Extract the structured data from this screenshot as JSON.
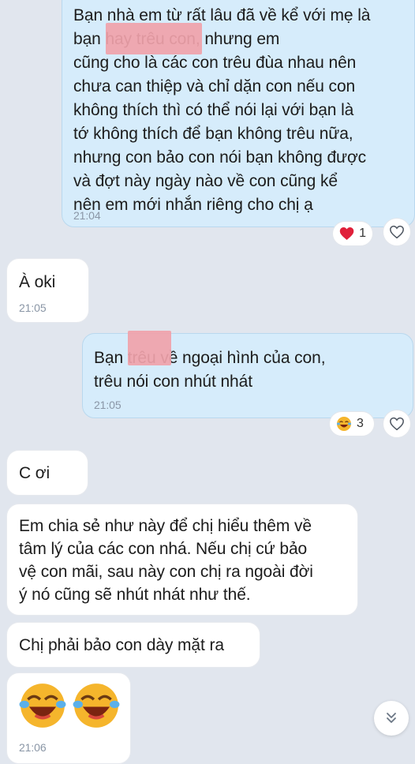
{
  "messages": [
    {
      "id": "m1",
      "side": "sent",
      "lines": [
        "Bạn nhà em từ rất lâu đã về kể với mẹ là",
        "bạn                   hay trêu con, nhưng em",
        "cũng cho là các con trêu đùa nhau nên",
        "chưa can thiệp và chỉ dặn con nếu con",
        "không thích thì có thể nói lại với bạn là",
        "tớ không thích để bạn không trêu nữa,",
        "nhưng con bảo con nói bạn không được",
        "và đợt này ngày nào về con cũng kể",
        "nên em mới nhắn riêng cho chị ạ"
      ],
      "time": "21:04",
      "reaction": {
        "emoji": "heart",
        "count": "1"
      }
    },
    {
      "id": "m2",
      "side": "received",
      "lines": [
        "À oki"
      ],
      "time": "21:05"
    },
    {
      "id": "m3",
      "side": "sent",
      "lines": [
        "Bạn          trêu về ngoại hình của con,",
        "trêu nói con nhút nhát"
      ],
      "time": "21:05",
      "reaction": {
        "emoji": "laughing-crying-face",
        "count": "3"
      }
    },
    {
      "id": "m4",
      "side": "received",
      "lines": [
        "C ơi"
      ]
    },
    {
      "id": "m5",
      "side": "received",
      "lines": [
        "Em chia sẻ như này để chị hiểu thêm về",
        "tâm lý của các con nhá. Nếu chị cứ bảo",
        "vệ con mãi, sau này con chị ra ngoài đời",
        "ý nó cũng sẽ nhút nhát như thế."
      ]
    },
    {
      "id": "m6",
      "side": "received",
      "lines": [
        "Chị phải bảo con dày mặt ra"
      ]
    },
    {
      "id": "m7",
      "side": "received",
      "sticker": [
        "laughing-crying-face",
        "laughing-crying-face"
      ],
      "time": "21:06"
    }
  ],
  "colors": {
    "background": "#e1e6ee",
    "sent_bubble": "#d6ecfb",
    "received_bubble": "#ffffff",
    "time_text": "#8a96a6",
    "redaction": "#f0a2aa",
    "heart": "#e0203a"
  },
  "controls": {
    "react_icon": "heart-outline-icon",
    "scroll_icon": "double-chevron-down-icon"
  }
}
